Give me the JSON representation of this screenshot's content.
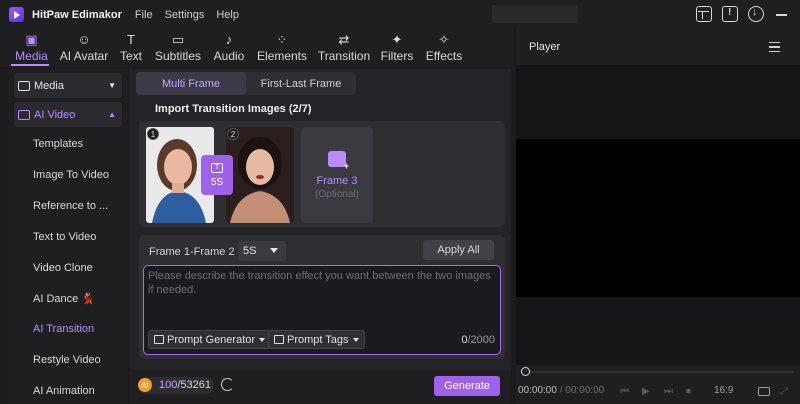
{
  "app": {
    "title": "HitPaw Edimakor",
    "menu": [
      "File",
      "Settings",
      "Help"
    ]
  },
  "toolbar": {
    "tabs": [
      {
        "label": "Media",
        "icon": "media-icon",
        "active": true
      },
      {
        "label": "AI Avatar",
        "icon": "avatar-icon"
      },
      {
        "label": "Text",
        "icon": "text-icon"
      },
      {
        "label": "Subtitles",
        "icon": "subtitles-icon"
      },
      {
        "label": "Audio",
        "icon": "audio-icon"
      },
      {
        "label": "Elements",
        "icon": "elements-icon"
      },
      {
        "label": "Transition",
        "icon": "transition-icon"
      },
      {
        "label": "Filters",
        "icon": "filters-icon"
      },
      {
        "label": "Effects",
        "icon": "effects-icon"
      }
    ],
    "accent": "#b78cff"
  },
  "sidebar": {
    "media_label": "Media",
    "ai_video_label": "AI Video",
    "items": [
      {
        "label": "Templates"
      },
      {
        "label": "Image To Video"
      },
      {
        "label": "Reference to ..."
      },
      {
        "label": "Text to Video"
      },
      {
        "label": "Video Clone"
      },
      {
        "label": "AI Dance 💃"
      },
      {
        "label": "AI Transition",
        "active": true
      },
      {
        "label": "Restyle Video"
      },
      {
        "label": "AI Animation"
      }
    ]
  },
  "main": {
    "mode_tabs": [
      {
        "label": "Multi Frame",
        "active": true
      },
      {
        "label": "First-Last Frame"
      }
    ],
    "import_title": "Import Transition Images (2/7)",
    "frames": [
      {
        "number": "1"
      },
      {
        "number": "2"
      }
    ],
    "transition_chip": {
      "icon_label": "T",
      "duration": "5S"
    },
    "add_frame": {
      "label": "Frame 3",
      "sublabel": "(Optional)"
    },
    "pair_label": "Frame 1-Frame 2",
    "duration_value": "5S",
    "apply_all_label": "Apply All",
    "prompt_placeholder": "Please describe the transition effect you want between the two images if needed.",
    "prompt_generator_label": "Prompt Generator",
    "prompt_tags_label": "Prompt Tags",
    "char_count": "0",
    "char_limit": "/2000"
  },
  "footer": {
    "credits_used": "100",
    "credits_total": "/53261",
    "generate_label": "Generate",
    "accent": "#9d62e9"
  },
  "player": {
    "title": "Player",
    "time_current": "00:00:00",
    "time_total": "/ 00:00:00",
    "aspect_ratio": "16:9"
  }
}
